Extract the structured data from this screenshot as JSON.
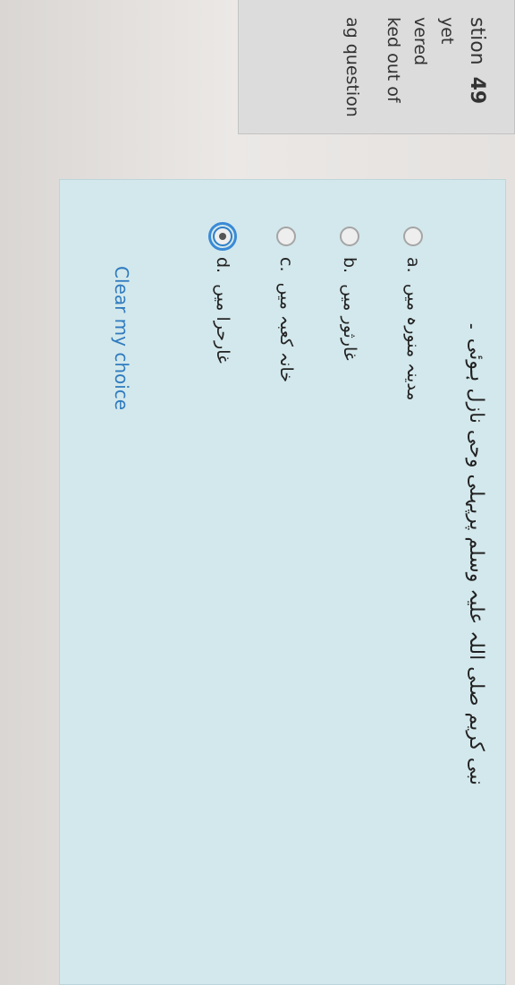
{
  "sidebar": {
    "question_label": "stion",
    "question_number": "49",
    "status_line1": "yet",
    "status_line2": "vered",
    "marked_line": "ked out of",
    "flag_label": "ag question"
  },
  "question": {
    "text": "نبی کریم صلی اللہ علیہ وسلم پرپہلی وحی نازل ہوئی ۔",
    "options": [
      {
        "letter": "a.",
        "text": "مدینہ منورہ میں",
        "selected": false
      },
      {
        "letter": "b.",
        "text": "غارثور میں",
        "selected": false
      },
      {
        "letter": "c.",
        "text": "خانہ کعبہ میں",
        "selected": false
      },
      {
        "letter": "d.",
        "text": "غارحرا میں",
        "selected": true
      }
    ],
    "clear_label": "Clear my choice"
  }
}
